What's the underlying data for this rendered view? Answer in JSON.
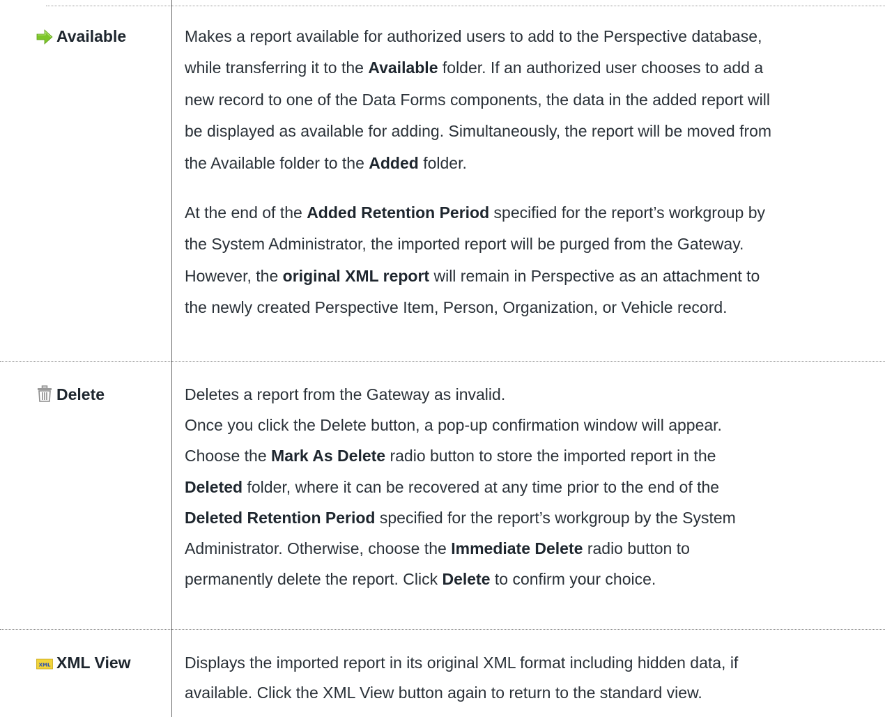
{
  "rows": [
    {
      "term": "Available",
      "icon": "green-right-arrow-icon",
      "paragraphs": [
        [
          [
            "Makes a report available for authorized users to add to the Perspective database,"
          ],
          [
            "while transferring it to the ",
            "Available",
            " folder. If an authorized user chooses to add a"
          ],
          [
            "new record to one of the Data Forms components, the data in the added report will"
          ],
          [
            "be displayed as available for adding. Simultaneously, the report will be moved from"
          ],
          [
            "the Available folder to the ",
            "Added",
            " folder."
          ]
        ],
        [
          [
            "At the end of the ",
            "Added Retention Period",
            " specified for the report’s workgroup by"
          ],
          [
            "the System Administrator, the imported report will be purged from the Gateway."
          ],
          [
            "However, the ",
            "original XML report",
            " will remain in Perspective as an attachment to"
          ],
          [
            "the newly created Perspective Item, Person, Organization, or Vehicle record."
          ]
        ]
      ]
    },
    {
      "term": "Delete",
      "icon": "trash-can-icon",
      "paragraphs": [
        [
          [
            "Deletes a report from the Gateway as invalid."
          ],
          [
            "Once you click the Delete button, a pop-up confirmation window will appear."
          ],
          [
            "Choose the ",
            "Mark As Delete",
            " radio button to store the imported report in the"
          ],
          [
            "",
            "Deleted",
            " folder, where it can be recovered at any time prior to the end of the"
          ],
          [
            "",
            "Deleted Retention Period",
            " specified for the report’s workgroup by the System"
          ],
          [
            "Administrator. Otherwise, choose the ",
            "Immediate Delete",
            " radio button to"
          ],
          [
            "permanently delete the report. Click ",
            "Delete",
            " to confirm your choice."
          ]
        ]
      ]
    },
    {
      "term": "XML View",
      "icon": "xml-file-icon",
      "icon_label": "XML",
      "paragraphs": [
        [
          [
            "Displays the imported report in its original XML format including hidden data, if"
          ],
          [
            "available. Click the XML View button again to return to the standard view."
          ]
        ]
      ]
    }
  ],
  "colors": {
    "text": "#2a3138",
    "arrow_green": "#7dc62a",
    "trash_gray": "#8c8c8c",
    "xml_yellow": "#f2d43a",
    "xml_blue": "#2b4fb0"
  }
}
